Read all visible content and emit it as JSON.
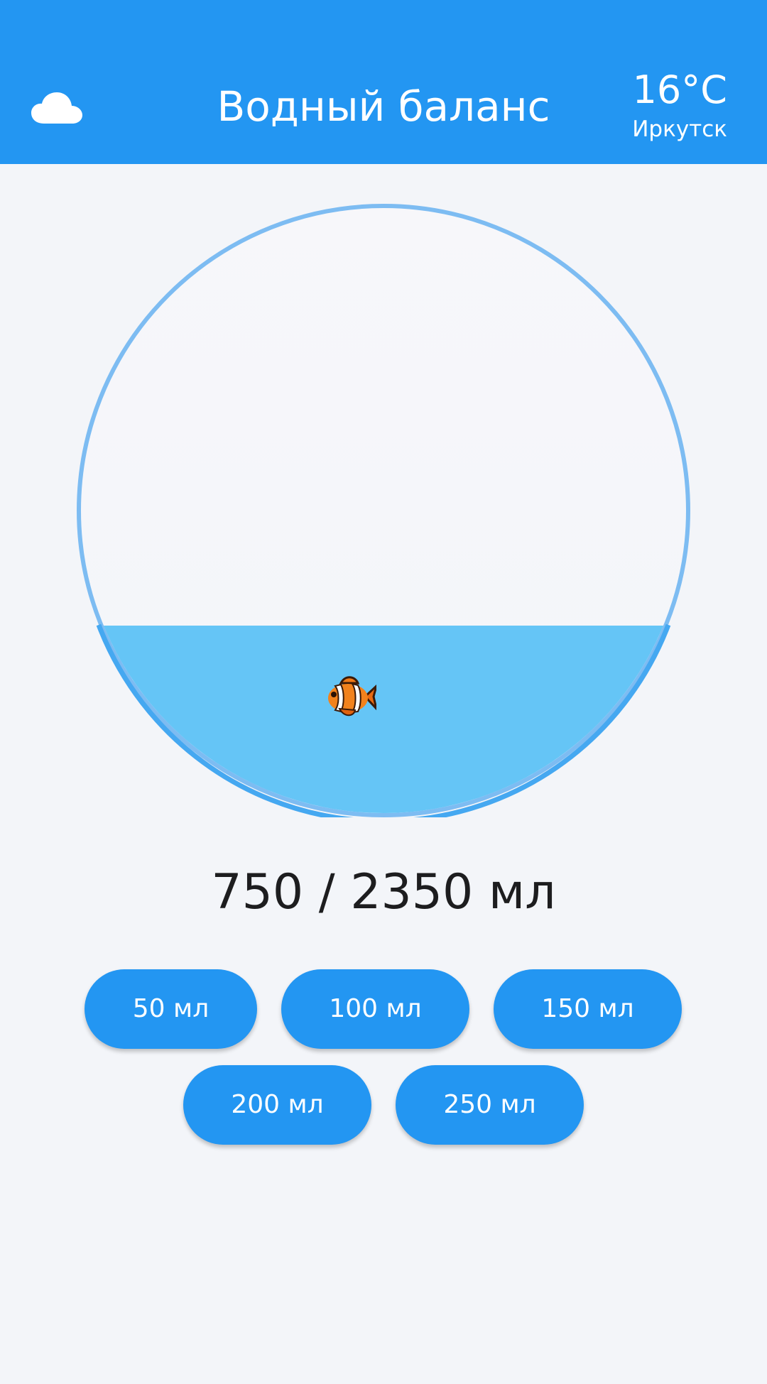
{
  "header": {
    "title": "Водный баланс",
    "weather_icon": "cloud-icon",
    "temperature": "16°C",
    "city": "Иркутск",
    "background_color": "#2396f2"
  },
  "tank": {
    "fill_fraction": 0.31,
    "water_color": "#65c5f6",
    "rim_color": "#7dbcf2",
    "fish_icon": "clownfish-icon"
  },
  "progress": {
    "text": "750 / 2350 мл"
  },
  "buttons": [
    {
      "label": "50 мл"
    },
    {
      "label": "100 мл"
    },
    {
      "label": "150 мл"
    },
    {
      "label": "200 мл"
    },
    {
      "label": "250 мл"
    }
  ],
  "colors": {
    "accent": "#2396f2",
    "background": "#f3f5f9"
  }
}
